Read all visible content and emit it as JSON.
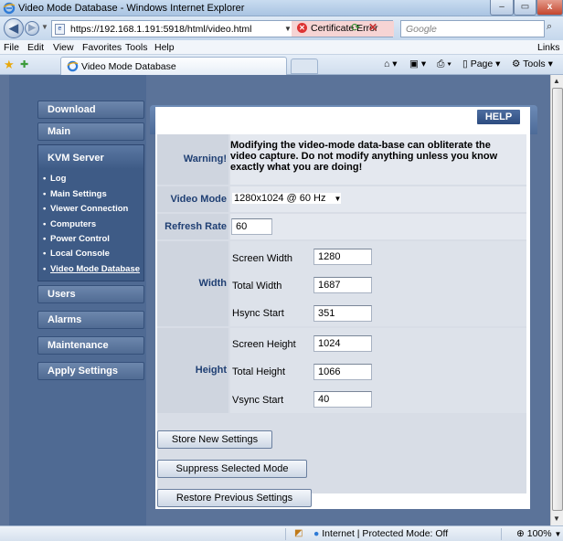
{
  "window": {
    "title": "Video Mode Database - Windows Internet Explorer",
    "min": "–",
    "max": "▭",
    "close": "x"
  },
  "address": {
    "url": "https://192.168.1.191:5918/html/video.html",
    "cert_error": "Certificate Error",
    "search_placeholder": "Google"
  },
  "menu": [
    "File",
    "Edit",
    "View",
    "Favorites",
    "Tools",
    "Help"
  ],
  "links_label": "Links",
  "tab": {
    "title": "Video Mode Database"
  },
  "commands": {
    "page": "Page",
    "tools": "Tools"
  },
  "sidebar": {
    "download": "Download",
    "main": "Main",
    "kvm_server": "KVM Server",
    "sub_items": [
      "Log",
      "Main Settings",
      "Viewer Connection",
      "Computers",
      "Power Control",
      "Local Console",
      "Video Mode Database"
    ],
    "users": "Users",
    "alarms": "Alarms",
    "maintenance": "Maintenance",
    "apply_settings": "Apply Settings"
  },
  "panel": {
    "title": "Video Mode Database",
    "help": "HELP"
  },
  "form": {
    "warning_label": "Warning!",
    "warning_text": "Modifying the video-mode data-base can obliterate the video capture. Do not modify anything unless you know exactly what you are doing!",
    "video_mode_label": "Video Mode",
    "video_mode_value": "1280x1024 @ 60 Hz",
    "refresh_rate_label": "Refresh Rate",
    "refresh_rate_value": "60",
    "width_label": "Width",
    "screen_width_label": "Screen Width",
    "screen_width_value": "1280",
    "total_width_label": "Total Width",
    "total_width_value": "1687",
    "hsync_start_label": "Hsync Start",
    "hsync_start_value": "351",
    "height_label": "Height",
    "screen_height_label": "Screen Height",
    "screen_height_value": "1024",
    "total_height_label": "Total Height",
    "total_height_value": "1066",
    "vsync_start_label": "Vsync Start",
    "vsync_start_value": "40"
  },
  "buttons": {
    "store": "Store New Settings",
    "suppress": "Suppress Selected Mode",
    "restore": "Restore Previous Settings"
  },
  "status": {
    "zone": "Internet | Protected Mode: Off",
    "zoom": "100%"
  }
}
